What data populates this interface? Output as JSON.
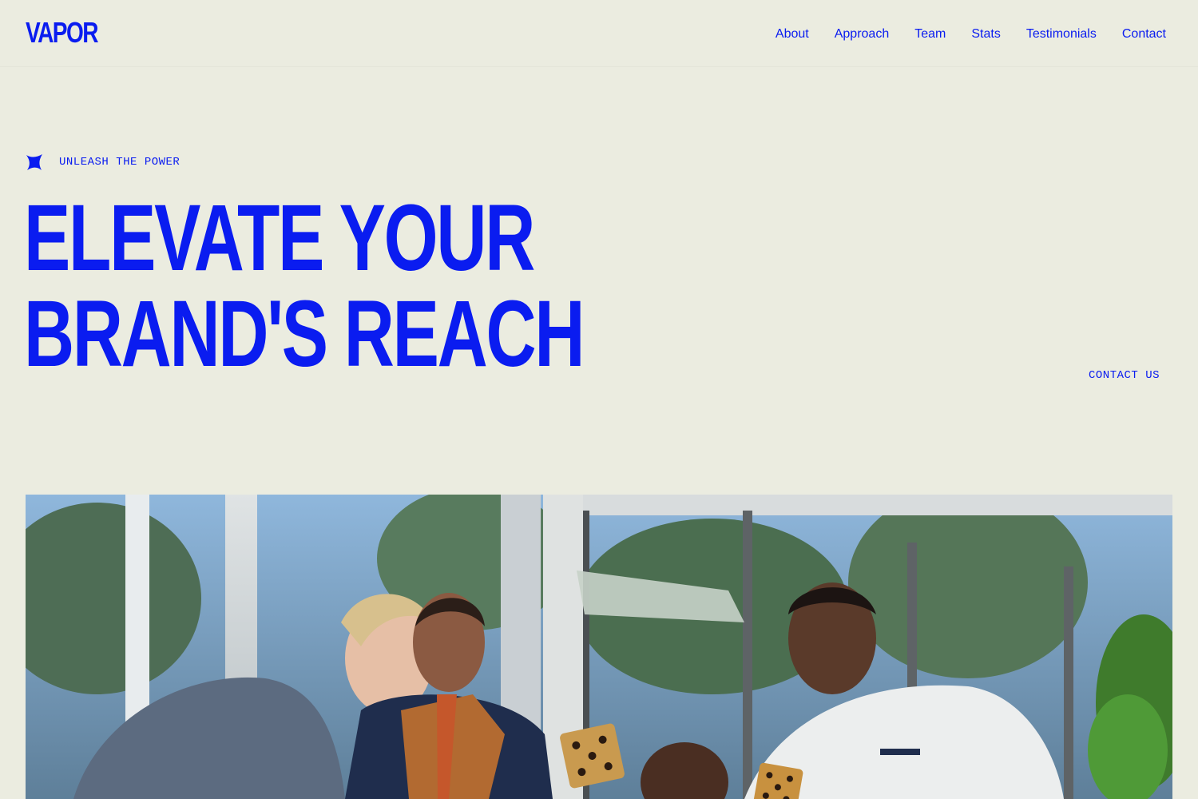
{
  "header": {
    "logo": "VAPOR",
    "nav": [
      "About",
      "Approach",
      "Team",
      "Stats",
      "Testimonials",
      "Contact"
    ]
  },
  "hero": {
    "eyebrow_icon": "sparkle-star-icon",
    "eyebrow": "UNLEASH THE POWER",
    "headline_line1": "ELEVATE YOUR",
    "headline_line2": "BRAND'S REACH",
    "cta": "CONTACT US"
  },
  "colors": {
    "background": "#ebece0",
    "accent": "#0a1cf0"
  }
}
